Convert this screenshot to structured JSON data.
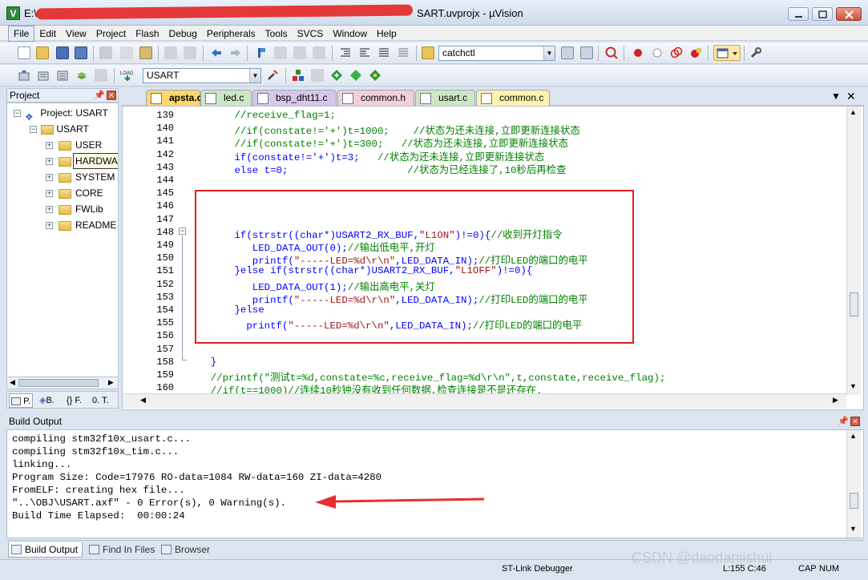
{
  "window": {
    "title_prefix": "E:\\",
    "title_suffix": "SART.uvprojx - µVision",
    "title_redacted_note": ""
  },
  "menu": [
    "File",
    "Edit",
    "View",
    "Project",
    "Flash",
    "Debug",
    "Peripherals",
    "Tools",
    "SVCS",
    "Window",
    "Help"
  ],
  "toolbar": {
    "find_combo": "catchctl",
    "target_combo": "USART"
  },
  "project": {
    "header": "Project",
    "root": "Project: USART",
    "target": "USART",
    "groups": [
      "USER",
      "HARDWARE",
      "SYSTEM",
      "CORE",
      "FWLib",
      "README"
    ],
    "tabs": [
      "P.",
      "B.",
      "{} F.",
      "0. T."
    ]
  },
  "editor": {
    "tabs": [
      {
        "label": "apsta.c",
        "active": true
      },
      {
        "label": "led.c",
        "active": false
      },
      {
        "label": "bsp_dht11.c",
        "active": false
      },
      {
        "label": "common.h",
        "active": false
      },
      {
        "label": "usart.c",
        "active": false
      },
      {
        "label": "common.c",
        "active": false
      }
    ],
    "lines": [
      {
        "n": "139",
        "code": "        //receive_flag=1;"
      },
      {
        "n": "140",
        "code": "        //if(constate!='+')t=1000;    //状态为还未连接,立即更新连接状态"
      },
      {
        "n": "141",
        "code": "        //if(constate!='+')t=300;   //状态为还未连接,立即更新连接状态"
      },
      {
        "n": "142",
        "code": "        if(constate!='+')t=3;   //状态为还未连接,立即更新连接状态"
      },
      {
        "n": "143",
        "code": "        else t=0;                    //状态为已经连接了,10秒后再检查"
      },
      {
        "n": "144",
        "code": ""
      },
      {
        "n": "145",
        "code": ""
      },
      {
        "n": "146",
        "code": ""
      },
      {
        "n": "147",
        "code": ""
      },
      {
        "n": "148",
        "code": "        if(strstr((char*)USART2_RX_BUF,\"L1ON\")!=0){//收到开灯指令"
      },
      {
        "n": "149",
        "code": "           LED_DATA_OUT(0);//输出低电平,开灯"
      },
      {
        "n": "150",
        "code": "           printf(\"-----LED=%d\\r\\n\",LED_DATA_IN);//打印LED的端口的电平"
      },
      {
        "n": "151",
        "code": "        }else if(strstr((char*)USART2_RX_BUF,\"L1OFF\")!=0){"
      },
      {
        "n": "152",
        "code": "           LED_DATA_OUT(1);//输出高电平,关灯"
      },
      {
        "n": "153",
        "code": "           printf(\"-----LED=%d\\r\\n\",LED_DATA_IN);//打印LED的端口的电平"
      },
      {
        "n": "154",
        "code": "        }else"
      },
      {
        "n": "155",
        "code": "          printf(\"-----LED=%d\\r\\n\",LED_DATA_IN);//打印LED的端口的电平"
      },
      {
        "n": "156",
        "code": ""
      },
      {
        "n": "157",
        "code": ""
      },
      {
        "n": "158",
        "code": "    }"
      },
      {
        "n": "159",
        "code": "    //printf(\"测试t=%d,constate=%c,receive_flag=%d\\r\\n\",t,constate,receive_flag);"
      },
      {
        "n": "160",
        "code": "    //if(t==1000)//连续10秒钟没有收到任何数据,检查连接是不是还存在."
      }
    ]
  },
  "build": {
    "header": "Build Output",
    "lines": [
      "compiling stm32f10x_usart.c...",
      "compiling stm32f10x_tim.c...",
      "linking...",
      "Program Size: Code=17976 RO-data=1084 RW-data=160 ZI-data=4280",
      "FromELF: creating hex file...",
      "\"..\\OBJ\\USART.axf\" - 0 Error(s), 0 Warning(s).",
      "Build Time Elapsed:  00:00:24"
    ],
    "tabs": [
      "Build Output",
      "Find In Files",
      "Browser"
    ]
  },
  "status": {
    "debugger": "ST-Link Debugger",
    "position": "L:155 C:46",
    "caps": "CAP",
    "num": "NUM"
  },
  "watermark": "CSDN @daodanjishui",
  "colors": {
    "highlight_box": "#e02020",
    "arrow": "#e53030",
    "comment": "#008000"
  }
}
